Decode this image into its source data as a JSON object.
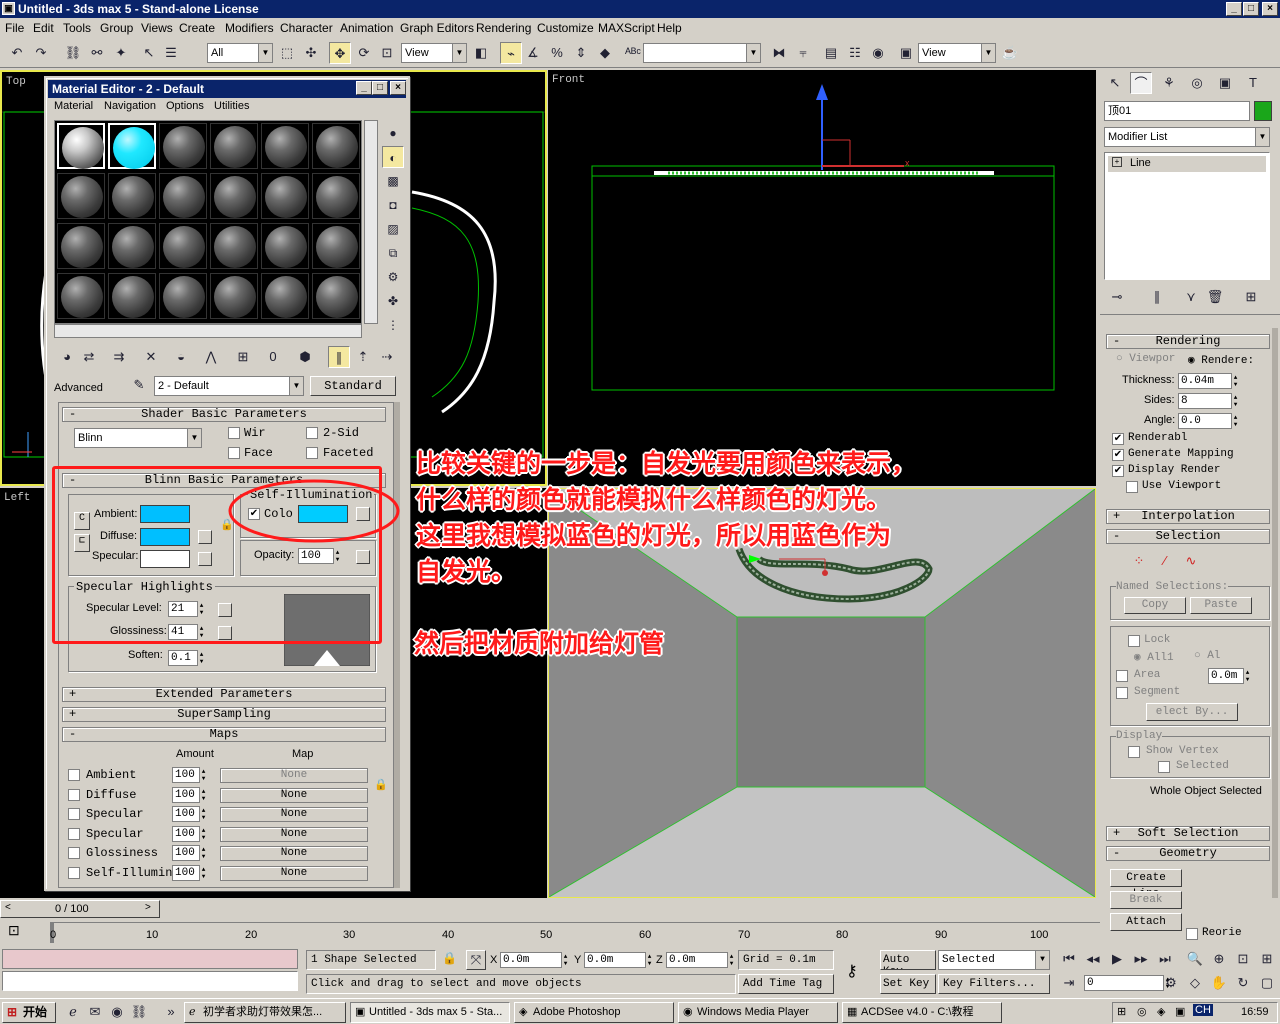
{
  "window": {
    "title": "Untitled - 3ds max 5 - Stand-alone License"
  },
  "menu": [
    "File",
    "Edit",
    "Tools",
    "Group",
    "Views",
    "Create",
    "Modifiers",
    "Character",
    "Animation",
    "Graph Editors",
    "Rendering",
    "Customize",
    "MAXScript",
    "Help"
  ],
  "toolbar": {
    "selection_filter": "All",
    "ref_coord": "View",
    "view2": "View"
  },
  "viewports": {
    "top": "Top",
    "front": "Front",
    "left": "Left"
  },
  "material_editor": {
    "title": "Material Editor - 2 - Default",
    "menu": [
      "Material",
      "Navigation",
      "Options",
      "Utilities"
    ],
    "advanced_label": "Advanced",
    "material_name": "2 - Default",
    "material_type": "Standard",
    "shader_rollout": "Shader Basic Parameters",
    "shader_type": "Blinn",
    "wire": "Wir",
    "two_sided": "2-Sid",
    "face_map": "Face",
    "faceted": "Faceted",
    "blinn_rollout": "Blinn Basic Parameters",
    "self_illum_title": "Self-Illumination",
    "color_label": "Colo",
    "ambient": "Ambient:",
    "diffuse": "Diffuse:",
    "specular": "Specular:",
    "opacity_label": "Opacity:",
    "opacity": "100",
    "spec_highlights": "Specular Highlights",
    "spec_level_label": "Specular Level:",
    "spec_level": "21",
    "glossiness_label": "Glossiness:",
    "glossiness": "41",
    "soften_label": "Soften:",
    "soften": "0.1",
    "extended_rollout": "Extended Parameters",
    "supersampling_rollout": "SuperSampling",
    "maps_rollout": "Maps",
    "amount_header": "Amount",
    "map_header": "Map",
    "maps": [
      {
        "name": "Ambient",
        "amount": "100",
        "map": "None"
      },
      {
        "name": "Diffuse",
        "amount": "100",
        "map": "None"
      },
      {
        "name": "Specular",
        "amount": "100",
        "map": "None"
      },
      {
        "name": "Specular",
        "amount": "100",
        "map": "None"
      },
      {
        "name": "Glossiness",
        "amount": "100",
        "map": "None"
      },
      {
        "name": "Self-Illumin",
        "amount": "100",
        "map": "None"
      }
    ],
    "illum_color": "#00ccff",
    "ambient_color": "#00bfff",
    "diffuse_color": "#00bfff",
    "specular_color": "#ffffff"
  },
  "annotation": {
    "line1": "比较关键的一步是：自发光要用颜色来表示，",
    "line2": "什么样的颜色就能模拟什么样颜色的灯光。",
    "line3": "这里我想模拟蓝色的灯光，所以用蓝色作为",
    "line4": "自发光。",
    "line5": "然后把材质附加给灯管"
  },
  "command_panel": {
    "object_name": "顶01",
    "modifier_list": "Modifier List",
    "stack_item": "Line",
    "rendering_rollout": "Rendering",
    "viewport_radio": "Viewpor",
    "renderer_radio": "Rendere:",
    "thickness_label": "Thickness:",
    "thickness": "0.04m",
    "sides_label": "Sides:",
    "sides": "8",
    "angle_label": "Angle:",
    "angle": "0.0",
    "renderable": "Renderabl",
    "gen_mapping": "Generate Mapping",
    "display_render": "Display Render",
    "use_viewport": "Use Viewport",
    "interpolation_rollout": "Interpolation",
    "selection_rollout": "Selection",
    "named_sel": "Named Selections:",
    "copy": "Copy",
    "paste": "Paste",
    "lock": "Lock",
    "all1": "All1",
    "all2": "Al",
    "area": "Area",
    "area_val": "0.0m",
    "segment": "Segment",
    "select_by": "elect By...",
    "display_group": "Display",
    "show_vertex": "Show Vertex",
    "selected": "Selected",
    "whole_object": "Whole Object Selected",
    "soft_selection_rollout": "Soft Selection",
    "geometry_rollout": "Geometry",
    "create_line": "Create Line",
    "break": "Break",
    "attach": "Attach",
    "reorient": "Reorie"
  },
  "timeline": {
    "frame": "0 / 100",
    "ticks": [
      "0",
      "10",
      "20",
      "30",
      "40",
      "50",
      "60",
      "70",
      "80",
      "90",
      "100"
    ]
  },
  "status": {
    "selection": "1 Shape Selected",
    "prompt": "Click and drag to select and move objects",
    "x": "0.0m",
    "y": "0.0m",
    "z": "0.0m",
    "grid": "Grid = 0.1m",
    "add_time_tag": "Add Time Tag",
    "auto_key": "Auto Key",
    "set_key": "Set Key",
    "key_mode": "Selected",
    "key_filters": "Key Filters...",
    "frame_field": "0"
  },
  "taskbar": {
    "start": "开始",
    "tasks": [
      "初学者求助灯带效果怎...",
      "Untitled - 3ds max 5 - Sta...",
      "Adobe Photoshop",
      "Windows Media Player",
      "ACDSee v4.0 - C:\\教程"
    ],
    "lang": "CH",
    "clock": "16:59"
  }
}
